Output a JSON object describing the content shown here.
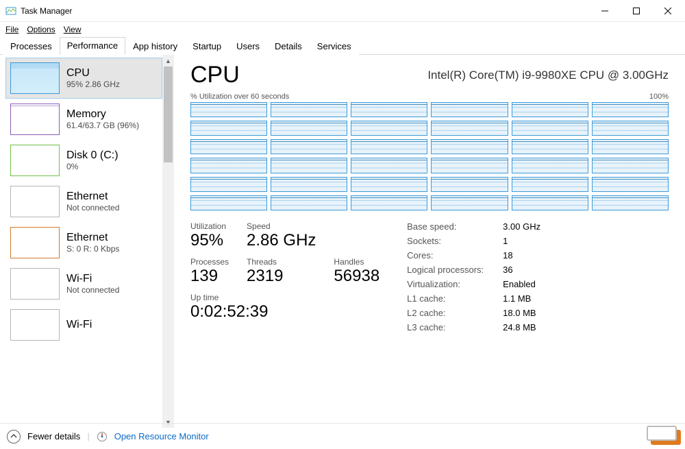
{
  "window": {
    "title": "Task Manager"
  },
  "menu": {
    "file": "File",
    "options": "Options",
    "view": "View"
  },
  "tabs": [
    "Processes",
    "Performance",
    "App history",
    "Startup",
    "Users",
    "Details",
    "Services"
  ],
  "activeTab": 1,
  "sidebar": {
    "items": [
      {
        "name": "CPU",
        "sub": "95%  2.86 GHz",
        "thumb": "cpu",
        "selected": true
      },
      {
        "name": "Memory",
        "sub": "61.4/63.7 GB (96%)",
        "thumb": "mem"
      },
      {
        "name": "Disk 0 (C:)",
        "sub": "0%",
        "thumb": "disk"
      },
      {
        "name": "Ethernet",
        "sub": "Not connected",
        "thumb": "eth1"
      },
      {
        "name": "Ethernet",
        "sub": "S: 0  R: 0 Kbps",
        "thumb": "eth2"
      },
      {
        "name": "Wi-Fi",
        "sub": "Not connected",
        "thumb": "wifi"
      },
      {
        "name": "Wi-Fi",
        "sub": "",
        "thumb": "wifi"
      }
    ]
  },
  "main": {
    "title": "CPU",
    "model": "Intel(R) Core(TM) i9-9980XE CPU @ 3.00GHz",
    "chartLabelLeft": "% Utilization over 60 seconds",
    "chartLabelRight": "100%",
    "stats": {
      "utilization": {
        "label": "Utilization",
        "value": "95%"
      },
      "speed": {
        "label": "Speed",
        "value": "2.86 GHz"
      },
      "processes": {
        "label": "Processes",
        "value": "139"
      },
      "threads": {
        "label": "Threads",
        "value": "2319"
      },
      "handles": {
        "label": "Handles",
        "value": "56938"
      },
      "uptime": {
        "label": "Up time",
        "value": "0:02:52:39"
      }
    },
    "specs": [
      {
        "label": "Base speed:",
        "value": "3.00 GHz"
      },
      {
        "label": "Sockets:",
        "value": "1"
      },
      {
        "label": "Cores:",
        "value": "18"
      },
      {
        "label": "Logical processors:",
        "value": "36"
      },
      {
        "label": "Virtualization:",
        "value": "Enabled"
      },
      {
        "label": "L1 cache:",
        "value": "1.1 MB"
      },
      {
        "label": "L2 cache:",
        "value": "18.0 MB"
      },
      {
        "label": "L3 cache:",
        "value": "24.8 MB"
      }
    ]
  },
  "footer": {
    "fewer": "Fewer details",
    "resmon": "Open Resource Monitor"
  },
  "chart_data": {
    "type": "area",
    "title": "% Utilization over 60 seconds",
    "xlabel": "seconds",
    "ylabel": "% utilization",
    "xlim": [
      0,
      60
    ],
    "ylim": [
      0,
      100
    ],
    "note": "36 logical-processor mini-charts arranged 6×6; each shows ~95% steady utilization over the 60s window",
    "series_count": 36,
    "representative_values": [
      95,
      95,
      95,
      95,
      95,
      95
    ]
  }
}
